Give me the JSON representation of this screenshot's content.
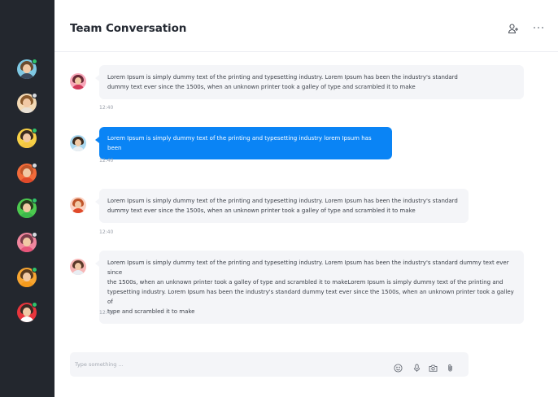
{
  "conversation": {
    "title": "Team Conversation"
  },
  "sidebar": {
    "contacts": [
      {
        "status": "online",
        "status_color": "#2fc36b",
        "hair": "#6b4a2e",
        "shirt": "#3a4a5e",
        "bg": "#7ec8e3"
      },
      {
        "status": "away",
        "status_color": "#d8dbe0",
        "hair": "#8a5a2c",
        "shirt": "#e8e0d4",
        "bg": "#f3d9b4"
      },
      {
        "status": "online",
        "status_color": "#2fc36b",
        "hair": "#3a2a1e",
        "shirt": "#f4c542",
        "bg": "#f7d046"
      },
      {
        "status": "away",
        "status_color": "#d8dbe0",
        "hair": "#c0562a",
        "shirt": "#e04a2a",
        "bg": "#f26b3a"
      },
      {
        "status": "online",
        "status_color": "#2fc36b",
        "hair": "#2a3a1e",
        "shirt": "#3cb84a",
        "bg": "#4cc94f"
      },
      {
        "status": "away",
        "status_color": "#d8dbe0",
        "hair": "#7a3c4a",
        "shirt": "#e7557a",
        "bg": "#f0869e"
      },
      {
        "status": "online",
        "status_color": "#2fc36b",
        "hair": "#5a3a1e",
        "shirt": "#f59a1c",
        "bg": "#f7a531"
      },
      {
        "status": "online",
        "status_color": "#2fc36b",
        "hair": "#3a2a24",
        "shirt": "#ffffff",
        "bg": "#e8353c"
      }
    ]
  },
  "messages": [
    {
      "type": "received",
      "text_lines": [
        "Lorem Ipsum is simply dummy text of the printing and typesetting industry. Lorem Ipsum has been the industry's standard",
        "dummy text ever since the 1500s, when an unknown printer took a galley of type and scrambled it to make"
      ],
      "time": "12:40",
      "avatar": {
        "hair": "#6a2a36",
        "shirt": "#d23a5a",
        "bg": "#f7a6b8"
      }
    },
    {
      "type": "sent",
      "text_lines": [
        "Lorem Ipsum is simply dummy text of the printing and typesetting industry lorem Ipsum has been"
      ],
      "time": "12:40",
      "avatar": {
        "hair": "#3a2a1e",
        "shirt": "#e9eef2",
        "bg": "#a9d8f0"
      }
    },
    {
      "type": "received",
      "text_lines": [
        "Lorem Ipsum is simply dummy text of the printing and typesetting industry. Lorem Ipsum has been the industry's standard",
        "dummy text ever since the 1500s, when an unknown printer took a galley of type and scrambled it to make"
      ],
      "time": "12:40",
      "avatar": {
        "hair": "#c0562a",
        "shirt": "#e04a2a",
        "bg": "#fbd3c4"
      }
    },
    {
      "type": "received",
      "text_lines": [
        "Lorem Ipsum is simply dummy text of the printing and typesetting industry. Lorem Ipsum has been the industry's standard dummy text ever since",
        "the 1500s, when an unknown printer took a galley of type and scrambled it to makeLorem Ipsum is simply dummy text of the printing and",
        "typesetting industry. Lorem Ipsum has been the industry's standard dummy text ever since the 1500s, when an unknown printer took a galley of",
        "type and scrambled it to make"
      ],
      "time": "12:40",
      "avatar": {
        "hair": "#5a3a2a",
        "shirt": "#e8edf2",
        "bg": "#f7b6b6"
      }
    }
  ],
  "composer": {
    "placeholder": "Type something ...",
    "value": "",
    "icons": [
      "emoji-icon",
      "microphone-icon",
      "camera-icon",
      "attachment-icon"
    ]
  },
  "header_icons": [
    "add-user-icon",
    "more-options-icon"
  ]
}
